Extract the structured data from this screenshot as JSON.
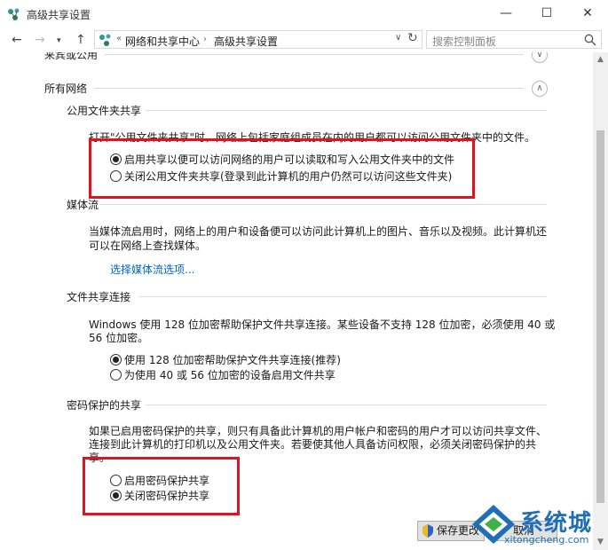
{
  "window": {
    "title": "高级共享设置",
    "minimize_glyph": "—",
    "maximize_glyph": "☐",
    "close_glyph": "✕"
  },
  "address_bar": {
    "crumb_overflow": "«",
    "crumbs": [
      "网络和共享中心",
      "高级共享设置"
    ],
    "search_placeholder": "搜索控制面板"
  },
  "partial_section": {
    "label": "来宾或公用"
  },
  "all_networks": {
    "label": "所有网络",
    "public_folder": {
      "heading": "公用文件夹共享",
      "description": "打开\"公用文件夹共享\"时，网络上包括家庭组成员在内的用户都可以访问公用文件夹中的文件。",
      "options": [
        {
          "label": "启用共享以便可以访问网络的用户可以读取和写入公用文件夹中的文件",
          "checked": true
        },
        {
          "label": "关闭公用文件夹共享(登录到此计算机的用户仍然可以访问这些文件夹)",
          "checked": false
        }
      ]
    },
    "media_streaming": {
      "heading": "媒体流",
      "description_line1": "当媒体流启用时，网络上的用户和设备便可以访问此计算机上的图片、音乐以及视频。此计算机还",
      "description_line2": "可以在网络上查找媒体。",
      "link": "选择媒体流选项..."
    },
    "file_sharing": {
      "heading": "文件共享连接",
      "description_line1": "Windows 使用 128 位加密帮助保护文件共享连接。某些设备不支持 128 位加密，必须使用 40 或",
      "description_line2": "56 位加密。",
      "options": [
        {
          "label": "使用 128 位加密帮助保护文件共享连接(推荐)",
          "checked": true
        },
        {
          "label": "为使用 40 或 56 位加密的设备启用文件共享",
          "checked": false
        }
      ]
    },
    "password_protected": {
      "heading": "密码保护的共享",
      "description_line1": "如果已启用密码保护的共享，则只有具备此计算机的用户帐户和密码的用户才可以访问共享文件、",
      "description_line2": "连接到此计算机的打印机以及公用文件夹。若要使其他人具备访问权限，必须关闭密码保护的共",
      "description_line3": "享。",
      "options": [
        {
          "label": "启用密码保护共享",
          "checked": false
        },
        {
          "label": "关闭密码保护共享",
          "checked": true
        }
      ]
    }
  },
  "footer": {
    "save_label": "保存更改",
    "cancel_label": "取消"
  },
  "watermark": {
    "brand": "系统城",
    "url": "xitongcheng.com"
  }
}
